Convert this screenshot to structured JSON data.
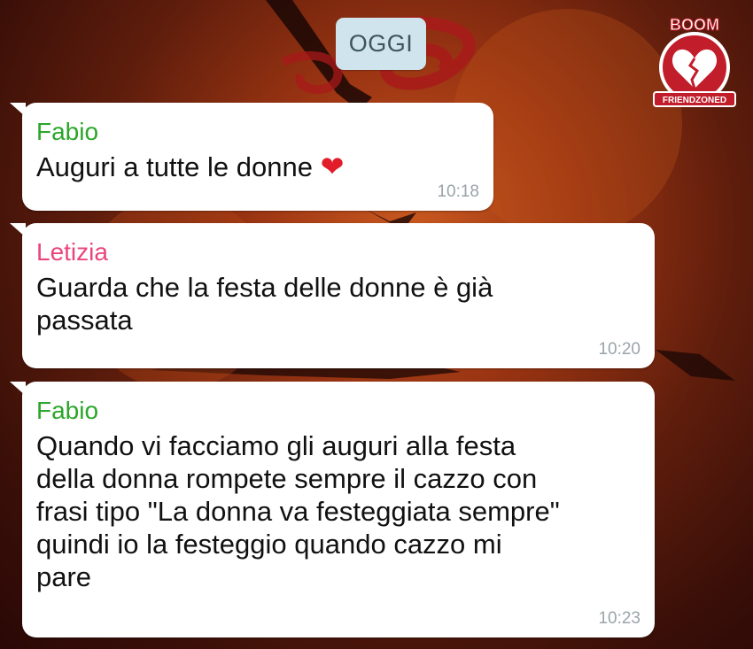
{
  "date_separator": "OGGI",
  "messages": [
    {
      "sender": "Fabio",
      "text": "Auguri a tutte le donne",
      "emoji": "❤",
      "time": "10:18"
    },
    {
      "sender": "Letizia",
      "line1": "Guarda che la festa delle donne è già",
      "line2": "passata",
      "time": "10:20"
    },
    {
      "sender": "Fabio",
      "lines": [
        "Quando vi facciamo gli auguri alla festa",
        "della donna rompete sempre il cazzo con",
        "frasi tipo \"La donna va festeggiata sempre\"",
        "quindi io la festeggio quando cazzo mi",
        "pare"
      ],
      "time": "10:23"
    }
  ],
  "watermark": {
    "top_text": "BOOM",
    "bottom_text": "FRIENDZONED",
    "icon": "broken-heart-icon"
  },
  "colors": {
    "sender_fabio": "#2aa62a",
    "sender_letizia": "#e9467d",
    "bubble": "#ffffff",
    "date_pill": "#cfe4ec"
  }
}
